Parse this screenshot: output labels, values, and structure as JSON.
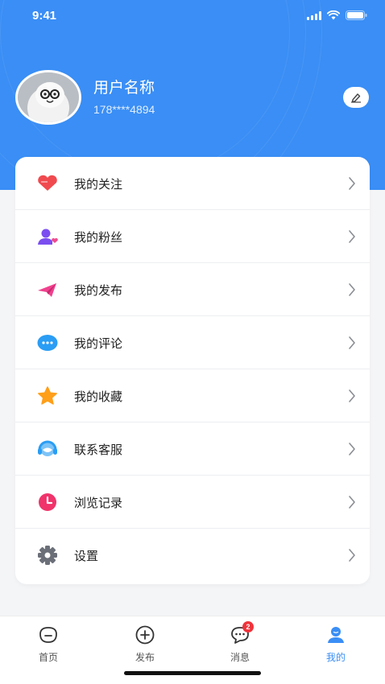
{
  "status_bar": {
    "time": "9:41"
  },
  "profile": {
    "name": "用户名称",
    "phone": "178****4894"
  },
  "menu": {
    "items": [
      {
        "label": "我的关注",
        "icon": "heart-icon",
        "color": "#f04a4f"
      },
      {
        "label": "我的粉丝",
        "icon": "user-heart-icon",
        "color": "#7b4ef0"
      },
      {
        "label": "我的发布",
        "icon": "paper-plane-icon",
        "color": "#f0428e"
      },
      {
        "label": "我的评论",
        "icon": "comment-icon",
        "color": "#2a9df4"
      },
      {
        "label": "我的收藏",
        "icon": "star-icon",
        "color": "#ff9f1a"
      },
      {
        "label": "联系客服",
        "icon": "headset-icon",
        "color": "#2a9df4"
      },
      {
        "label": "浏览记录",
        "icon": "clock-icon",
        "color": "#f0336a"
      },
      {
        "label": "设置",
        "icon": "gear-icon",
        "color": "#6b6f78"
      }
    ]
  },
  "tab_bar": {
    "tabs": [
      {
        "label": "首页",
        "icon": "home-icon"
      },
      {
        "label": "发布",
        "icon": "plus-circle-icon"
      },
      {
        "label": "消息",
        "icon": "message-icon",
        "badge": "2"
      },
      {
        "label": "我的",
        "icon": "profile-icon",
        "active": true
      }
    ]
  },
  "colors": {
    "primary": "#3a8ef5",
    "badge": "#f0333b"
  }
}
